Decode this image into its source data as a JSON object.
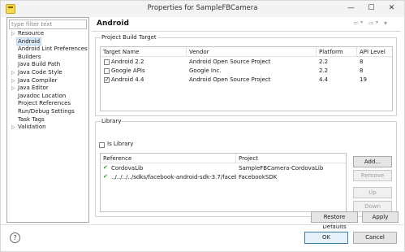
{
  "window": {
    "title": "Properties for SampleFBCamera",
    "minimize_glyph": "—",
    "maximize_glyph": "☐",
    "close_glyph": "✕"
  },
  "sidebar": {
    "filter_placeholder": "type filter text",
    "items": [
      {
        "label": "Resource",
        "expandable": true
      },
      {
        "label": "Android",
        "expandable": false,
        "selected": true
      },
      {
        "label": "Android Lint Preferences",
        "expandable": false
      },
      {
        "label": "Builders",
        "expandable": false
      },
      {
        "label": "Java Build Path",
        "expandable": false
      },
      {
        "label": "Java Code Style",
        "expandable": true
      },
      {
        "label": "Java Compiler",
        "expandable": true
      },
      {
        "label": "Java Editor",
        "expandable": true
      },
      {
        "label": "Javadoc Location",
        "expandable": false
      },
      {
        "label": "Project References",
        "expandable": false
      },
      {
        "label": "Run/Debug Settings",
        "expandable": false
      },
      {
        "label": "Task Tags",
        "expandable": false
      },
      {
        "label": "Validation",
        "expandable": true
      }
    ]
  },
  "page": {
    "title": "Android",
    "nav": {
      "back": "⇦",
      "back_dd": "▾",
      "forward": "⇨",
      "forward_dd": "▾",
      "menu": "▾"
    }
  },
  "build_target": {
    "group_label": "Project Build Target",
    "columns": [
      "Target Name",
      "Vendor",
      "Platform",
      "API Level"
    ],
    "rows": [
      {
        "checked": false,
        "name": "Android 2.2",
        "vendor": "Android Open Source Project",
        "platform": "2.2",
        "api": "8"
      },
      {
        "checked": false,
        "name": "Google APIs",
        "vendor": "Google Inc.",
        "platform": "2.2",
        "api": "8"
      },
      {
        "checked": true,
        "name": "Android 4.4",
        "vendor": "Android Open Source Project",
        "platform": "4.4",
        "api": "19"
      }
    ]
  },
  "library": {
    "group_label": "Library",
    "is_library_label": "Is Library",
    "is_library_checked": false,
    "columns": [
      "Reference",
      "Project"
    ],
    "rows": [
      {
        "reference": "CordovaLib",
        "project": "SampleFBCamera-CordovaLib"
      },
      {
        "reference": "../../../../sdks/facebook-android-sdk-3.7/facebook",
        "project": "FacebookSDK"
      }
    ],
    "buttons": {
      "add": "Add...",
      "remove": "Remove",
      "up": "Up",
      "down": "Down"
    }
  },
  "actions": {
    "restore_defaults": "Restore Defaults",
    "apply": "Apply",
    "ok": "OK",
    "cancel": "Cancel",
    "help_glyph": "?"
  }
}
